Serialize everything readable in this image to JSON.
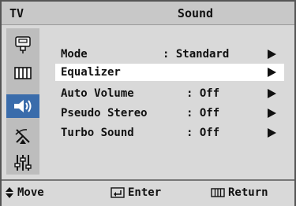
{
  "header": {
    "tv_label": "TV",
    "title": "Sound"
  },
  "sidebar": {
    "items": [
      {
        "icon": "input-icon"
      },
      {
        "icon": "picture-icon"
      },
      {
        "icon": "speaker-icon",
        "active": true
      },
      {
        "icon": "antenna-icon"
      },
      {
        "icon": "setup-icon"
      }
    ]
  },
  "menu": {
    "items": [
      {
        "label": "Mode",
        "value": ": Standard"
      },
      {
        "label": "Equalizer",
        "value": ""
      },
      {
        "label": "Auto Volume",
        "value": ": Off"
      },
      {
        "label": "Pseudo Stereo",
        "value": ": Off"
      },
      {
        "label": "Turbo Sound",
        "value": ": Off"
      }
    ],
    "selected_index": 1
  },
  "footer": {
    "move_label": "Move",
    "enter_label": "Enter",
    "return_label": "Return"
  },
  "colors": {
    "accent": "#3a6cab",
    "panel": "#d9d9d9",
    "selected_row": "#ffffff"
  }
}
